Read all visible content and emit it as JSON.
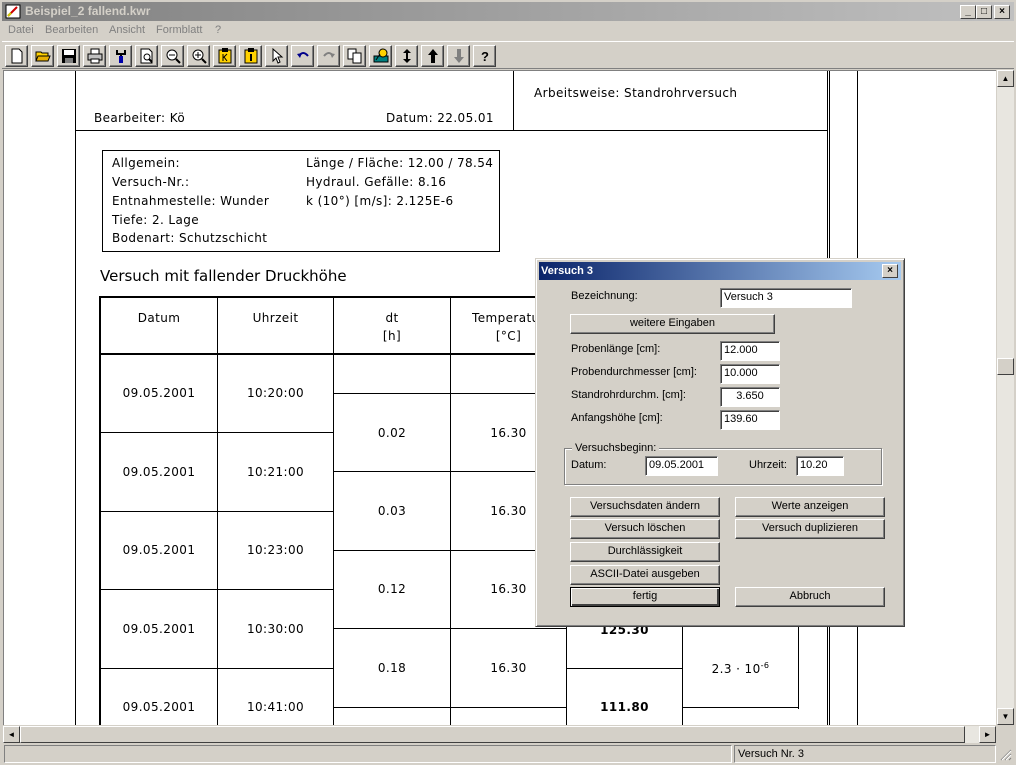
{
  "window": {
    "title": "Beispiel_2 fallend.kwr",
    "controls": {
      "minimize": "_",
      "maximize": "□",
      "close": "×"
    }
  },
  "menu": [
    "Datei",
    "Bearbeiten",
    "Ansicht",
    "Formblatt",
    "?"
  ],
  "toolbar_icons": [
    "new-icon",
    "open-icon",
    "save-icon",
    "print-icon",
    "tool-icon",
    "preview-icon",
    "zoom-out-icon",
    "zoom-in-icon",
    "page-k-icon",
    "page-l-icon",
    "pointer-icon",
    "undo-icon",
    "redo-icon",
    "copy-icon",
    "chart-icon",
    "resize-vertical-icon",
    "arrow-up-icon",
    "arrow-down-icon",
    "help-icon"
  ],
  "help_label": "?",
  "document": {
    "arbeitsweise": "Arbeitsweise:  Standrohrversuch",
    "bearbeiter": "Bearbeiter:  Kö",
    "datum": "Datum:  22.05.01",
    "info_left": [
      "Allgemein:",
      "Versuch-Nr.:",
      "Entnahmestelle: Wunder",
      "Tiefe: 2. Lage",
      "Bodenart: Schutzschicht"
    ],
    "info_right": [
      "Länge / Fläche: 12.00 / 78.54",
      "Hydraul. Gefälle: 8.16",
      "k (10°) [m/s]:  2.125E-6"
    ],
    "table_title": "Versuch mit fallender Druckhöhe",
    "headers": {
      "datum": "Datum",
      "uhrzeit": "Uhrzeit",
      "dt": "dt",
      "dt_unit": "[h]",
      "temp": "Temperatur",
      "temp_unit": "[°C]"
    },
    "rows": [
      {
        "datum": "09.05.2001",
        "uhrzeit": "10:20:00"
      },
      {
        "datum": "09.05.2001",
        "uhrzeit": "10:21:00"
      },
      {
        "datum": "09.05.2001",
        "uhrzeit": "10:23:00"
      },
      {
        "datum": "09.05.2001",
        "uhrzeit": "10:30:00"
      },
      {
        "datum": "09.05.2001",
        "uhrzeit": "10:41:00"
      }
    ],
    "intervals": [
      {
        "dt": "0.02",
        "temp": "16.30"
      },
      {
        "dt": "0.03",
        "temp": "16.30"
      },
      {
        "dt": "0.12",
        "temp": "16.30"
      },
      {
        "dt": "0.18",
        "temp": "16.30"
      }
    ],
    "hoehe_1": "125.30",
    "hoehe_2": "111.80",
    "k_value": "2.3 · 10",
    "k_exp": "-6"
  },
  "dialog": {
    "title": "Versuch 3",
    "bezeichnung_label": "Bezeichnung:",
    "bezeichnung_value": "Versuch 3",
    "weitere_label": "weitere Eingaben",
    "fields": [
      {
        "label": "Probenlänge [cm]:",
        "value": "12.000"
      },
      {
        "label": "Probendurchmesser [cm]:",
        "value": "10.000"
      },
      {
        "label": "Standrohrdurchm. [cm]:",
        "value": "3.650"
      },
      {
        "label": "Anfangshöhe [cm]:",
        "value": "139.60"
      }
    ],
    "group_title": "Versuchsbeginn:",
    "datum_label": "Datum:",
    "datum_value": "09.05.2001",
    "uhrzeit_label": "Uhrzeit:",
    "uhrzeit_value": "10.20",
    "buttons": {
      "aendern": "Versuchsdaten ändern",
      "anzeigen": "Werte anzeigen",
      "loeschen": "Versuch löschen",
      "duplizieren": "Versuch duplizieren",
      "durchlaessigkeit": "Durchlässigkeit",
      "ascii": "ASCII-Datei ausgeben",
      "fertig": "fertig",
      "abbruch": "Abbruch"
    }
  },
  "status": {
    "pane2": "Versuch Nr. 3"
  }
}
